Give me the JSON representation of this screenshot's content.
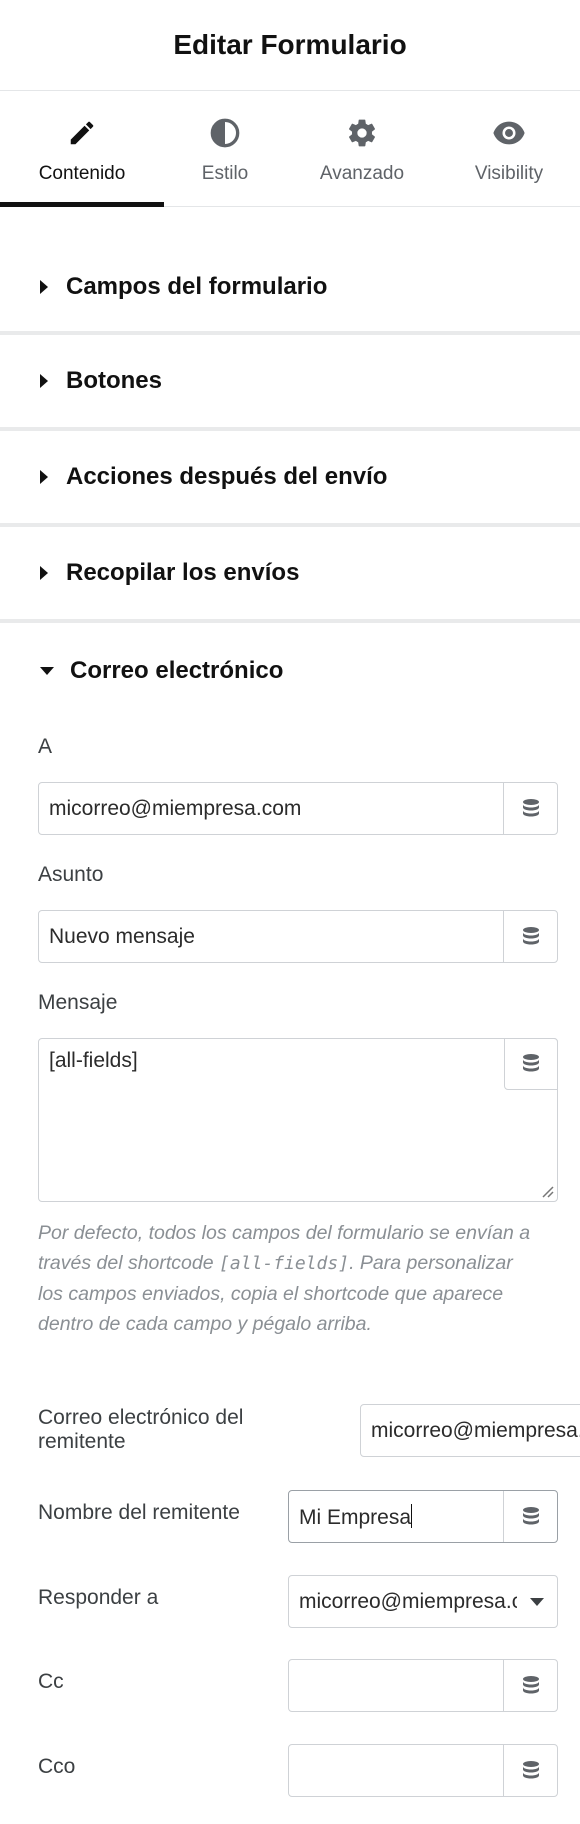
{
  "header": {
    "title": "Editar Formulario"
  },
  "tabs": [
    {
      "label": "Contenido",
      "icon": "pencil-icon"
    },
    {
      "label": "Estilo",
      "icon": "contrast-icon"
    },
    {
      "label": "Avanzado",
      "icon": "gear-icon"
    },
    {
      "label": "Visibility",
      "icon": "eye-icon"
    }
  ],
  "sections": [
    {
      "label": "Campos del formulario"
    },
    {
      "label": "Botones"
    },
    {
      "label": "Acciones después del envío"
    },
    {
      "label": "Recopilar los envíos"
    },
    {
      "label": "Correo electrónico"
    }
  ],
  "email": {
    "to_label": "A",
    "to_value": "micorreo@miempresa.com",
    "subject_label": "Asunto",
    "subject_value": "Nuevo mensaje",
    "message_label": "Mensaje",
    "message_value": "[all-fields]",
    "help_text_1": "Por defecto, todos los campos del formulario se envían a través del shortcode ",
    "help_code": "[all-fields]",
    "help_text_2": ". Para personalizar los campos enviados, copia el shortcode que aparece dentro de cada campo y pégalo arriba.",
    "from_email_label": "Correo electrónico del remitente",
    "from_email_value": "micorreo@miempresa.com",
    "from_name_label": "Nombre del remitente",
    "from_name_value": "Mi Empresa",
    "reply_to_label": "Responder a",
    "reply_to_value": "micorreo@miempresa.com",
    "cc_label": "Cc",
    "cc_value": "",
    "bcc_label": "Cco",
    "bcc_value": ""
  },
  "colors": {
    "accent": "#111111",
    "border": "#cfd2d6",
    "help_text": "#8a8f94"
  }
}
